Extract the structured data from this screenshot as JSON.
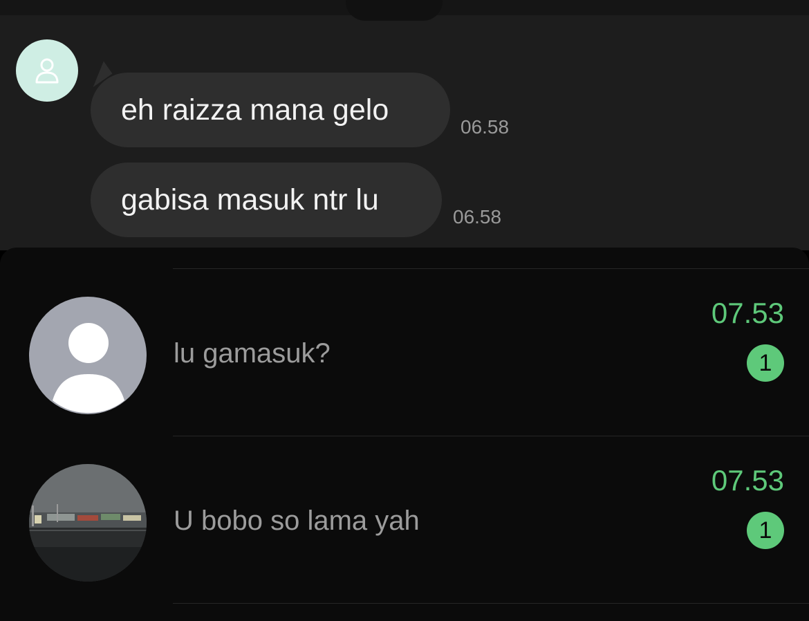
{
  "chat": {
    "messages": [
      {
        "text": "eh raizza mana gelo",
        "time": "06.58"
      },
      {
        "text": "gabisa masuk ntr lu",
        "time": "06.58"
      }
    ],
    "sender_avatar_icon": "person-outline-icon"
  },
  "chat_list": {
    "rows": [
      {
        "avatar": "default-person-avatar",
        "preview": "lu gamasuk?",
        "time": "07.53",
        "unread": "1"
      },
      {
        "avatar": "photo-avatar",
        "preview": "U bobo so lama yah",
        "time": "07.53",
        "unread": "1"
      }
    ]
  },
  "colors": {
    "chat_background": "#1d1d1d",
    "bubble": "#2e2e2e",
    "list_background": "#0b0b0b",
    "accent_green": "#5ec97a",
    "sender_avatar_bg": "#cfeee4"
  }
}
